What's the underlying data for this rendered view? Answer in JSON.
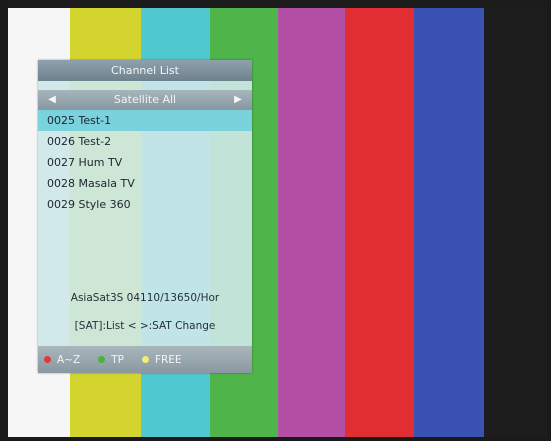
{
  "colors": {
    "bars": [
      "#d4d42e",
      "#50c8cf",
      "#4fb449",
      "#b44fa6",
      "#e02e32",
      "#3a52b4",
      "#1d1d1d"
    ],
    "red": "#e0383c",
    "green": "#49b33f",
    "yellow": "#f2ec7a"
  },
  "panel": {
    "title": "Channel List",
    "satellite": "Satellite All",
    "channels": [
      {
        "num": "0025",
        "name": "Test-1"
      },
      {
        "num": "0026",
        "name": "Test-2"
      },
      {
        "num": "0027",
        "name": "Hum TV"
      },
      {
        "num": "0028",
        "name": "Masala TV"
      },
      {
        "num": "0029",
        "name": "Style 360"
      }
    ],
    "info": "AsiaSat3S    04110/13650/Hor",
    "hint": "[SAT]:List  < >:SAT Change",
    "legend": {
      "red_label": "A~Z",
      "green_label": "TP",
      "yellow_label": "FREE"
    }
  }
}
